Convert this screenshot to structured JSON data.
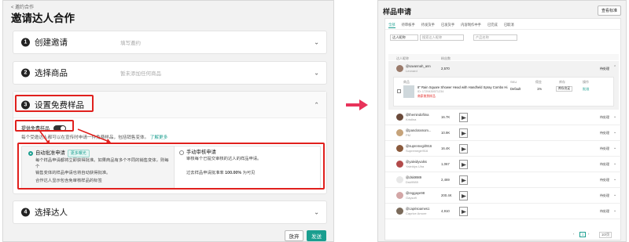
{
  "left": {
    "back": "< 邀约合作",
    "title": "邀请达人合作",
    "steps": [
      {
        "num": "1",
        "label": "创建邀请",
        "hint": "填写邀约"
      },
      {
        "num": "2",
        "label": "选择商品",
        "hint": "暂未添加任何商品"
      },
      {
        "num": "3",
        "label": "设置免费样品",
        "hint": ""
      },
      {
        "num": "4",
        "label": "选择达人",
        "hint": ""
      }
    ],
    "free_sample_label": "提供免费样品",
    "desc": "每个受邀达人都可以在宣传时申请一件免费样品，包括销售变体。",
    "learn_more": "了解更多",
    "auto": {
      "title": "自动批准申请",
      "tag": "更多曝光",
      "line1": "每个样品申请都将立即获得批准。如果商品有多个不同的销售变体，则每个",
      "line2": "销售变体的样品申请也将自动获得批准。",
      "line3": "合作达人显示包含免审核样品的标签"
    },
    "manual": {
      "title": "手动审核申请",
      "line1": "审核每个已提交审核的达人的样品申请。",
      "rate_label": "过去样品申请批准率",
      "rate_value": "100.00%",
      "rate_suffix": "为可见"
    },
    "cancel": "放弃",
    "send": "发送"
  },
  "right": {
    "title": "样品申请",
    "rules": "查看标准",
    "tabs": [
      "全部",
      "待审核手",
      "待发货手",
      "已发货手",
      "内容制作中手",
      "已完成",
      "已取消"
    ],
    "creator_select": "达人昵称",
    "search_placeholder": "搜索达人昵称",
    "product_placeholder": "产品名称",
    "col_creator": "达人昵称",
    "col_followers": "粉丝数",
    "expanded": {
      "name": "@savannah_ann",
      "sub": "Leonard",
      "followers": "2,570",
      "status": "待处理",
      "col_product": "商品",
      "col_sku": "SKU",
      "col_commission": "佣金",
      "col_stock": "库存",
      "col_action": "操作",
      "product_name": "8\" Rain Square Shower Head with Handheld Spray Combo Hi...",
      "product_id": "ID: 1729430071234",
      "product_note": "商家收到样品",
      "sku": "Default",
      "commission": "1%",
      "stock": "库存充足",
      "action": "批准"
    },
    "rows": [
      {
        "name": "@themindoftina",
        "sub": "Kristina",
        "followers": "16.7K",
        "status": "待处理",
        "color": "#6a4a3a"
      },
      {
        "name": "@pandoramom...",
        "sub": "PM",
        "followers": "10.9K",
        "status": "待处理",
        "color": "#c6a37a"
      },
      {
        "name": "@supremegirl916",
        "sub": "Supremegirl916",
        "followers": "16.4K",
        "status": "待处理",
        "color": "#8a5a3c"
      },
      {
        "name": "@yaleidyvalss",
        "sub": "Yaleidys Ulra",
        "followers": "1,067",
        "status": "待处理",
        "color": "#b24a4a"
      },
      {
        "name": "@dsk9989",
        "sub": "Dsk9989",
        "followers": "2,469",
        "status": "待处理",
        "color": "#e8e8e8"
      },
      {
        "name": "@reggaye98",
        "sub": "Gaysoft",
        "followers": "200.4K",
        "status": "待处理",
        "color": "#d3a6a6"
      },
      {
        "name": "@caprisoames1",
        "sub": "Caprice Amore",
        "followers": "4,910",
        "status": "待处理",
        "color": "#7a6a5a"
      }
    ],
    "page": "1",
    "per_page": "10/页"
  }
}
